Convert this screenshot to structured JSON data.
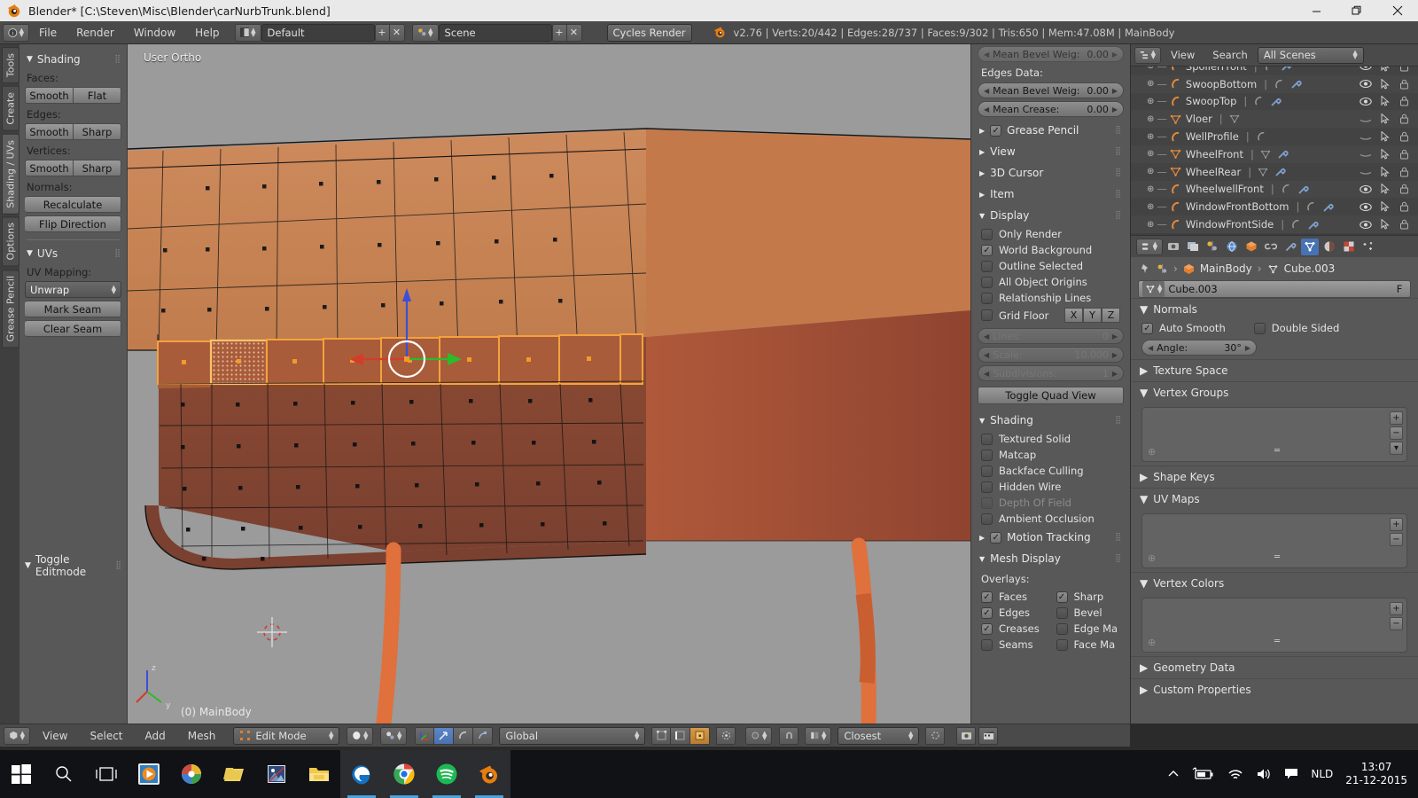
{
  "window": {
    "title": "Blender* [C:\\Steven\\Misc\\Blender\\carNurbTrunk.blend]",
    "minimize": "—",
    "restore": "❐",
    "close": "✕"
  },
  "topbar": {
    "menus": [
      "File",
      "Render",
      "Window",
      "Help"
    ],
    "screen_layout": "Default",
    "scene": "Scene",
    "engine": "Cycles Render",
    "stats": "v2.76 | Verts:20/442 | Edges:28/737 | Faces:9/302 | Tris:650 | Mem:47.08M | MainBody",
    "add_label": "+",
    "remove_label": "✕"
  },
  "toolshelf": {
    "tabs": [
      "Tools",
      "Create",
      "Shading / UVs",
      "Options",
      "Grease Pencil"
    ],
    "active_tab": "Shading / UVs",
    "shading": {
      "title": "Shading",
      "faces_label": "Faces:",
      "faces": [
        "Smooth",
        "Flat"
      ],
      "edges_label": "Edges:",
      "edges": [
        "Smooth",
        "Sharp"
      ],
      "vertices_label": "Vertices:",
      "vertices": [
        "Smooth",
        "Sharp"
      ],
      "normals_label": "Normals:",
      "normals": [
        "Recalculate",
        "Flip Direction"
      ]
    },
    "uvs": {
      "title": "UVs",
      "mapping_label": "UV Mapping:",
      "mapping_value": "Unwrap",
      "buttons": [
        "Mark Seam",
        "Clear Seam"
      ]
    },
    "toggle_editmode": "Toggle Editmode"
  },
  "viewport": {
    "view_label": "User Ortho",
    "object_label": "(0) MainBody"
  },
  "npanel": {
    "mean_bevel_weight_top": {
      "label": "Mean Bevel Weig:",
      "value": "0.00"
    },
    "edges_data_label": "Edges Data:",
    "mean_bevel_weight": {
      "label": "Mean Bevel Weig:",
      "value": "0.00"
    },
    "mean_crease": {
      "label": "Mean Crease:",
      "value": "0.00"
    },
    "collapsed_sections": [
      "Grease Pencil",
      "View",
      "3D Cursor",
      "Item"
    ],
    "display": {
      "title": "Display",
      "checks": [
        {
          "label": "Only Render",
          "checked": false
        },
        {
          "label": "World Background",
          "checked": true
        },
        {
          "label": "Outline Selected",
          "checked": false
        },
        {
          "label": "All Object Origins",
          "checked": false
        },
        {
          "label": "Relationship Lines",
          "checked": false
        }
      ],
      "grid_floor": {
        "label": "Grid Floor",
        "checked": false,
        "axes": [
          "X",
          "Y",
          "Z"
        ]
      },
      "lines": {
        "label": "Lines:",
        "value": "0"
      },
      "scale": {
        "label": "Scale:",
        "value": "10.000"
      },
      "subdivisions": {
        "label": "Subdivisions:",
        "value": "1"
      },
      "toggle_quad_view": "Toggle Quad View"
    },
    "shading": {
      "title": "Shading",
      "checks": [
        {
          "label": "Textured Solid",
          "checked": false,
          "dim": false
        },
        {
          "label": "Matcap",
          "checked": false,
          "dim": false
        },
        {
          "label": "Backface Culling",
          "checked": false,
          "dim": false
        },
        {
          "label": "Hidden Wire",
          "checked": false,
          "dim": false
        },
        {
          "label": "Depth Of Field",
          "checked": false,
          "dim": true
        },
        {
          "label": "Ambient Occlusion",
          "checked": false,
          "dim": false
        }
      ]
    },
    "motion_tracking": {
      "label": "Motion Tracking",
      "checked": true
    },
    "mesh_display": {
      "title": "Mesh Display",
      "overlays_label": "Overlays:",
      "overlays": [
        {
          "label": "Faces",
          "checked": true
        },
        {
          "label": "Sharp",
          "checked": true
        },
        {
          "label": "Edges",
          "checked": true
        },
        {
          "label": "Bevel",
          "checked": false
        },
        {
          "label": "Creases",
          "checked": true
        },
        {
          "label": "Edge Ma",
          "checked": false
        },
        {
          "label": "Seams",
          "checked": false
        },
        {
          "label": "Face Ma",
          "checked": false
        }
      ]
    }
  },
  "outliner": {
    "view_label": "View",
    "search_label": "Search",
    "display_mode": "All Scenes",
    "items": [
      {
        "name": "SpoilerFront",
        "type": "curve",
        "visible": true,
        "has_modifier": true
      },
      {
        "name": "SwoopBottom",
        "type": "curve",
        "visible": true,
        "has_modifier": true
      },
      {
        "name": "SwoopTop",
        "type": "curve",
        "visible": true,
        "has_modifier": true
      },
      {
        "name": "Vloer",
        "type": "mesh",
        "visible": false,
        "has_modifier": false
      },
      {
        "name": "WellProfile",
        "type": "curve",
        "visible": false,
        "has_modifier": false
      },
      {
        "name": "WheelFront",
        "type": "mesh",
        "visible": false,
        "has_modifier": true
      },
      {
        "name": "WheelRear",
        "type": "mesh",
        "visible": false,
        "has_modifier": true
      },
      {
        "name": "WheelwellFront",
        "type": "curve",
        "visible": true,
        "has_modifier": true
      },
      {
        "name": "WindowFrontBottom",
        "type": "curve",
        "visible": true,
        "has_modifier": true
      },
      {
        "name": "WindowFrontSide",
        "type": "curve",
        "visible": true,
        "has_modifier": true
      }
    ]
  },
  "properties": {
    "breadcrumb_object": "MainBody",
    "breadcrumb_data": "Cube.003",
    "datablock_name": "Cube.003",
    "fake_user_label": "F",
    "normals": {
      "title": "Normals",
      "auto_smooth": {
        "label": "Auto Smooth",
        "checked": true
      },
      "double_sided": {
        "label": "Double Sided",
        "checked": false
      },
      "angle": {
        "label": "Angle:",
        "value": "30°"
      }
    },
    "sections": [
      {
        "title": "Texture Space",
        "open": false
      },
      {
        "title": "Vertex Groups",
        "open": true
      },
      {
        "title": "Shape Keys",
        "open": false
      },
      {
        "title": "UV Maps",
        "open": true
      },
      {
        "title": "Vertex Colors",
        "open": true
      },
      {
        "title": "Geometry Data",
        "open": false
      },
      {
        "title": "Custom Properties",
        "open": false
      }
    ]
  },
  "viewheader": {
    "menus": [
      "View",
      "Select",
      "Add",
      "Mesh"
    ],
    "mode": "Edit Mode",
    "transform_orientation": "Global",
    "snap_target": "Closest"
  },
  "taskbar": {
    "icons": [
      "start-icon",
      "search-icon",
      "task-view-icon",
      "media-player-icon",
      "picasa-icon",
      "folder-yellow-icon",
      "photo-icon",
      "file-explorer-icon",
      "edge-icon",
      "chrome-icon",
      "spotify-icon",
      "blender-icon"
    ],
    "language": "NLD",
    "time": "13:07",
    "date": "21-12-2015"
  },
  "colors": {
    "accent_orange": "#f09020",
    "blender_bg": "#585858",
    "select_blue": "#4772b3",
    "axis_x": "#d43b2b",
    "axis_y": "#2bbb2b",
    "axis_z": "#3a4fd8"
  }
}
